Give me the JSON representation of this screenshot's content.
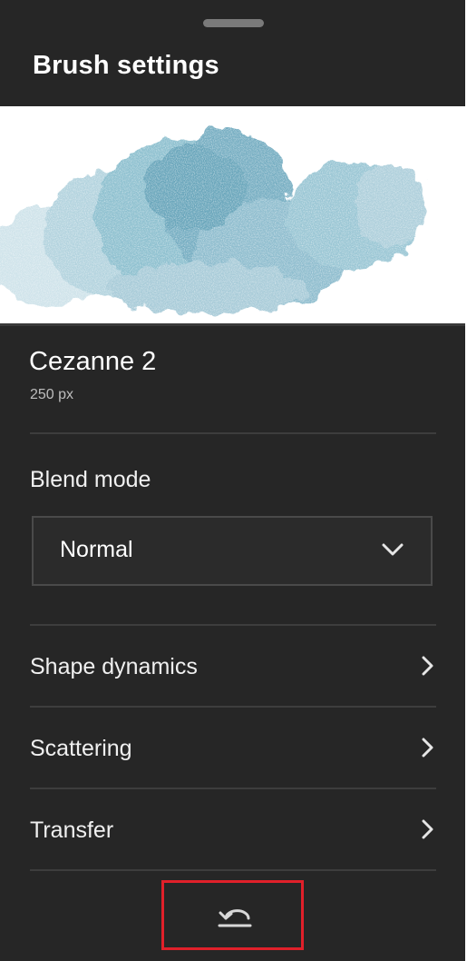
{
  "panel": {
    "title": "Brush settings"
  },
  "brush": {
    "name": "Cezanne 2",
    "size": "250 px"
  },
  "blend_mode": {
    "label": "Blend mode",
    "selected": "Normal"
  },
  "sections": [
    {
      "label": "Shape dynamics",
      "icon": "chevron-right-icon"
    },
    {
      "label": "Scattering",
      "icon": "chevron-right-icon"
    },
    {
      "label": "Transfer",
      "icon": "chevron-right-icon"
    }
  ],
  "reset": {
    "icon": "reset-icon",
    "highlight_color": "#e0202a"
  },
  "colors": {
    "panel_background": "#262626",
    "brush_stroke": "#7fb3c4"
  }
}
